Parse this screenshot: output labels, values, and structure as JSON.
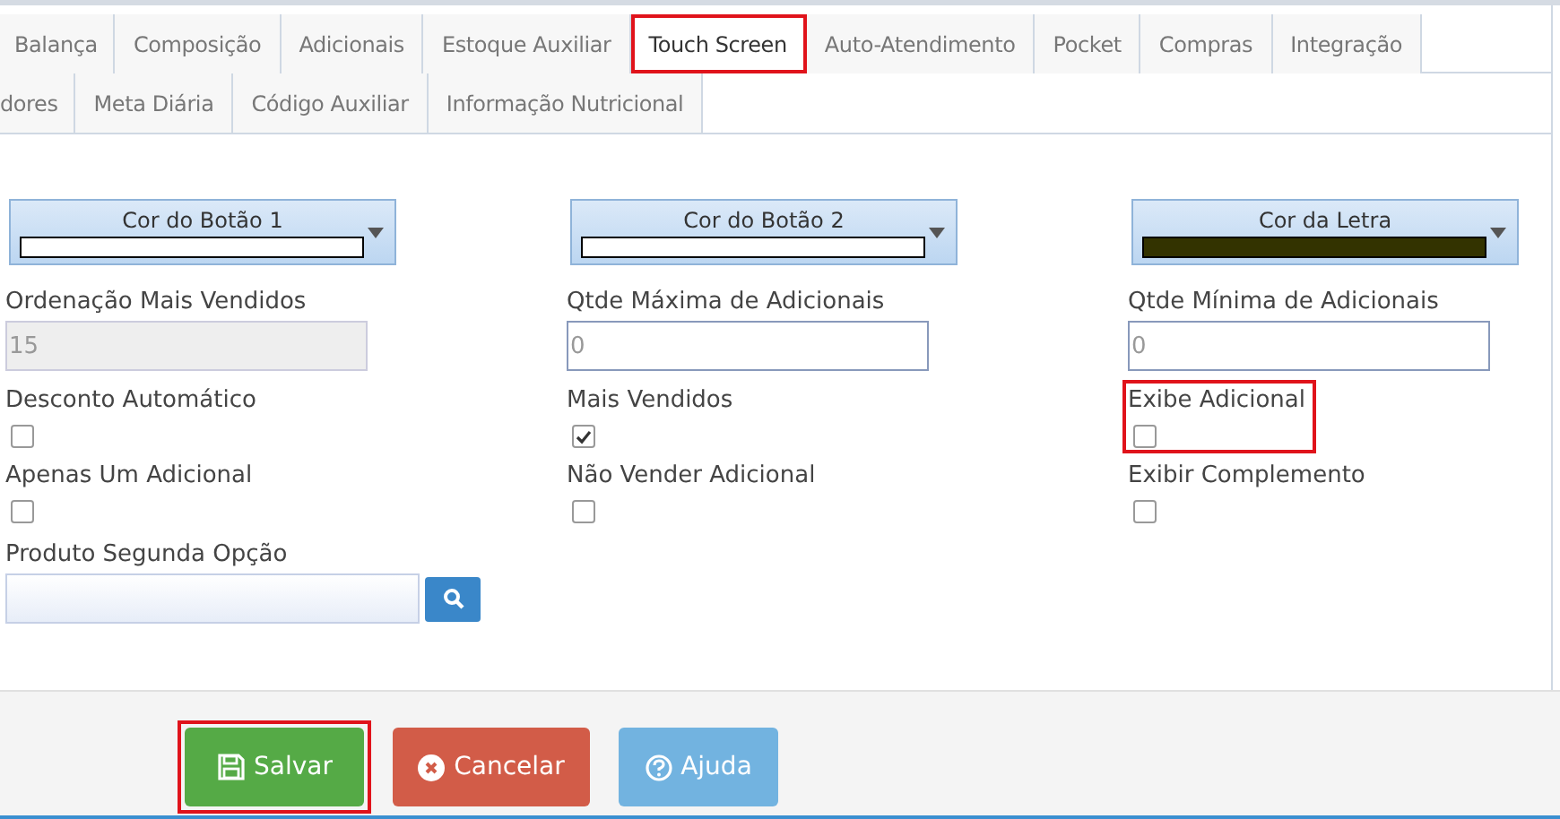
{
  "tab_rows": [
    [
      {
        "label": "Balança",
        "selected": false,
        "highlighted": false
      },
      {
        "label": "Composição",
        "selected": false,
        "highlighted": false
      },
      {
        "label": "Adicionais",
        "selected": false,
        "highlighted": false
      },
      {
        "label": "Estoque Auxiliar",
        "selected": false,
        "highlighted": false
      },
      {
        "label": "Touch Screen",
        "selected": true,
        "highlighted": true
      },
      {
        "label": "Auto-Atendimento",
        "selected": false,
        "highlighted": false
      },
      {
        "label": "Pocket",
        "selected": false,
        "highlighted": false
      },
      {
        "label": "Compras",
        "selected": false,
        "highlighted": false
      },
      {
        "label": "Integração",
        "selected": false,
        "highlighted": false
      }
    ],
    [
      {
        "label": "dores",
        "selected": false,
        "highlighted": false
      },
      {
        "label": "Meta Diária",
        "selected": false,
        "highlighted": false
      },
      {
        "label": "Código Auxiliar",
        "selected": false,
        "highlighted": false
      },
      {
        "label": "Informação Nutricional",
        "selected": false,
        "highlighted": false
      }
    ]
  ],
  "color_pickers": [
    {
      "label": "Cor do Botão 1",
      "color": "#ffffff"
    },
    {
      "label": "Cor do Botão 2",
      "color": "#ffffff"
    },
    {
      "label": "Cor da Letra",
      "color": "#333300"
    }
  ],
  "number_fields": [
    {
      "label": "Ordenação Mais Vendidos",
      "value": "15",
      "disabled": true
    },
    {
      "label": "Qtde Máxima de Adicionais",
      "value": "0",
      "disabled": false
    },
    {
      "label": "Qtde Mínima de Adicionais",
      "value": "0",
      "disabled": false
    }
  ],
  "checkboxes": [
    {
      "label": "Desconto Automático",
      "checked": false,
      "highlighted": false
    },
    {
      "label": "Mais Vendidos",
      "checked": true,
      "highlighted": false
    },
    {
      "label": "Exibe Adicional",
      "checked": false,
      "highlighted": true
    },
    {
      "label": "Apenas Um Adicional",
      "checked": false,
      "highlighted": false
    },
    {
      "label": "Não Vender Adicional",
      "checked": false,
      "highlighted": false
    },
    {
      "label": "Exibir Complemento",
      "checked": false,
      "highlighted": false
    }
  ],
  "product_field": {
    "label": "Produto Segunda Opção"
  },
  "buttons": [
    {
      "kind": "save",
      "label": "Salvar",
      "highlighted": true
    },
    {
      "kind": "cancel",
      "label": "Cancelar",
      "highlighted": false
    },
    {
      "kind": "help",
      "label": "Ajuda",
      "highlighted": false
    }
  ]
}
